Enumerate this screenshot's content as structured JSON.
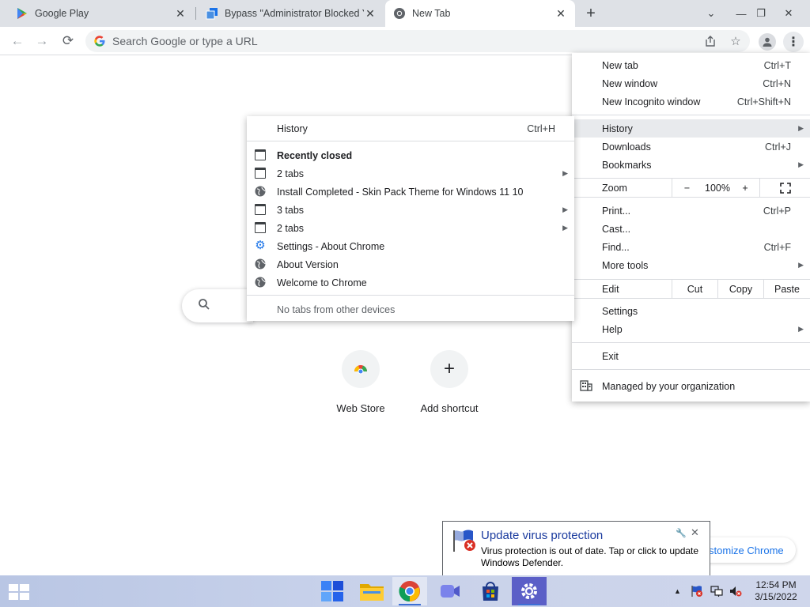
{
  "tabs": [
    {
      "title": "Google Play",
      "icon": "play-icon",
      "active": false
    },
    {
      "title": "Bypass \"Administrator Blocked Yo",
      "icon": "tabbed-page-icon",
      "active": false
    },
    {
      "title": "New Tab",
      "icon": "chrome-icon",
      "active": true
    }
  ],
  "window_controls": {
    "minimize": "—",
    "restore": "❐",
    "close": "✕"
  },
  "omnibox": {
    "placeholder": "Search Google or type a URL"
  },
  "ntp": {
    "shortcuts": [
      {
        "label": "Web Store",
        "icon": "chrome-web-store-icon"
      },
      {
        "label": "Add shortcut",
        "icon": "plus-icon"
      }
    ],
    "customize_label": "stomize Chrome"
  },
  "chrome_menu": {
    "new_tab": {
      "label": "New tab",
      "shortcut": "Ctrl+T"
    },
    "new_window": {
      "label": "New window",
      "shortcut": "Ctrl+N"
    },
    "new_incognito": {
      "label": "New Incognito window",
      "shortcut": "Ctrl+Shift+N"
    },
    "history": {
      "label": "History"
    },
    "downloads": {
      "label": "Downloads",
      "shortcut": "Ctrl+J"
    },
    "bookmarks": {
      "label": "Bookmarks"
    },
    "zoom": {
      "label": "Zoom",
      "minus": "−",
      "value": "100%",
      "plus": "+"
    },
    "print": {
      "label": "Print...",
      "shortcut": "Ctrl+P"
    },
    "cast": {
      "label": "Cast..."
    },
    "find": {
      "label": "Find...",
      "shortcut": "Ctrl+F"
    },
    "more_tools": {
      "label": "More tools"
    },
    "edit": {
      "label": "Edit",
      "cut": "Cut",
      "copy": "Copy",
      "paste": "Paste"
    },
    "settings": {
      "label": "Settings"
    },
    "help": {
      "label": "Help"
    },
    "exit": {
      "label": "Exit"
    },
    "managed": {
      "label": "Managed by your organization"
    }
  },
  "history_menu": {
    "history": {
      "label": "History",
      "shortcut": "Ctrl+H"
    },
    "recently_closed": "Recently closed",
    "items": [
      {
        "label": "2 tabs",
        "icon": "window-icon",
        "arrow": true
      },
      {
        "label": "Install Completed - Skin Pack Theme for Windows 11  10",
        "icon": "globe-icon",
        "arrow": false
      },
      {
        "label": "3 tabs",
        "icon": "window-icon",
        "arrow": true
      },
      {
        "label": "2 tabs",
        "icon": "window-icon",
        "arrow": true
      },
      {
        "label": "Settings - About Chrome",
        "icon": "gear-icon",
        "arrow": false
      },
      {
        "label": "About Version",
        "icon": "globe-icon",
        "arrow": false
      },
      {
        "label": "Welcome to Chrome",
        "icon": "globe-icon",
        "arrow": false
      }
    ],
    "no_other_devices": "No tabs from other devices"
  },
  "defender_balloon": {
    "title": "Update virus protection",
    "body": "Virus protection is out of date. Tap or click to update Windows Defender."
  },
  "taskbar": {
    "apps": [
      "windows-logo",
      "widgets-icon",
      "file-explorer-icon",
      "chrome-icon",
      "teams-chat-icon",
      "microsoft-store-icon",
      "settings-icon"
    ],
    "clock_time": "12:54 PM",
    "clock_date": "3/15/2022"
  },
  "colors": {
    "accent": "#1a73e8",
    "tab_strip": "#dee1e6",
    "menu_hover": "#e8eaed",
    "taskbar": "#c7d1ea"
  }
}
